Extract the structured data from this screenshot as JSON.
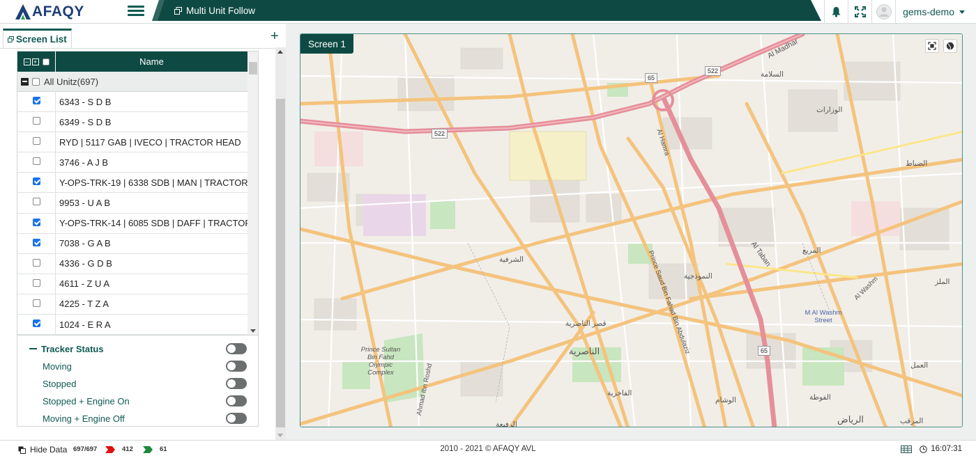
{
  "header": {
    "logo_text": "AFAQY",
    "active_tab_label": "Multi Unit Follow",
    "user_name": "gems-demo"
  },
  "left_panel": {
    "tab_label": "Screen List",
    "add_symbol": "+",
    "grid": {
      "name_column": "Name",
      "group_label": "All Unitz(697)",
      "rows": [
        {
          "name": "6343 - S D B",
          "checked": true
        },
        {
          "name": "6349 - S D B",
          "checked": false
        },
        {
          "name": "RYD | 5117 GAB | IVECO | TRACTOR HEAD",
          "checked": false
        },
        {
          "name": "3746 - A J B",
          "checked": false
        },
        {
          "name": "Y-OPS-TRK-19 | 6338 SDB | MAN | TRACTOR H",
          "checked": true
        },
        {
          "name": "9953 - U A B",
          "checked": false
        },
        {
          "name": "Y-OPS-TRK-14 | 6085 SDB | DAFF | TRACTOR H",
          "checked": true
        },
        {
          "name": "7038 - G A B",
          "checked": true
        },
        {
          "name": "4336 - G D B",
          "checked": false
        },
        {
          "name": "4611 - Z U A",
          "checked": false
        },
        {
          "name": "4225 - T Z A",
          "checked": false
        },
        {
          "name": "1024 - E R A",
          "checked": true
        }
      ]
    },
    "tracker_status": {
      "title": "Tracker Status",
      "items": [
        "Moving",
        "Stopped",
        "Stopped + Engine On",
        "Moving + Engine Off"
      ]
    }
  },
  "map": {
    "screen_label": "Screen 1",
    "place_labels": [
      "Al Madhar",
      "Al Taban",
      "Prince Sultan Bin Fahd Olympic Complex",
      "Ahmad Ibn Roshd",
      "Prince Saud Bin Fahad Bin Abdulaziz",
      "Al Hamra",
      "M Al Washm Street",
      "Al Washm"
    ],
    "arabic_labels": [
      "السلامة",
      "الوزارات",
      "الضباط",
      "المربع",
      "الشرفية",
      "النموذجية",
      "قصر الناصرية",
      "الناصرية",
      "الفاخرية",
      "الرفيعة",
      "الوشام",
      "الفوطة",
      "الرياض",
      "العمل",
      "المرقب",
      "الملز"
    ],
    "route_shields": [
      "522",
      "522",
      "65",
      "65"
    ]
  },
  "footer": {
    "hide_data_label": "Hide Data",
    "total_count": "697/697",
    "red_count": "412",
    "green_count": "61",
    "copyright": "2010 - 2021 © AFAQY AVL",
    "time": "16:07:31"
  },
  "colors": {
    "primary_teal": "#0e4a43",
    "checkbox_blue": "#1a73e8",
    "logo_blue": "#1d3e78"
  }
}
